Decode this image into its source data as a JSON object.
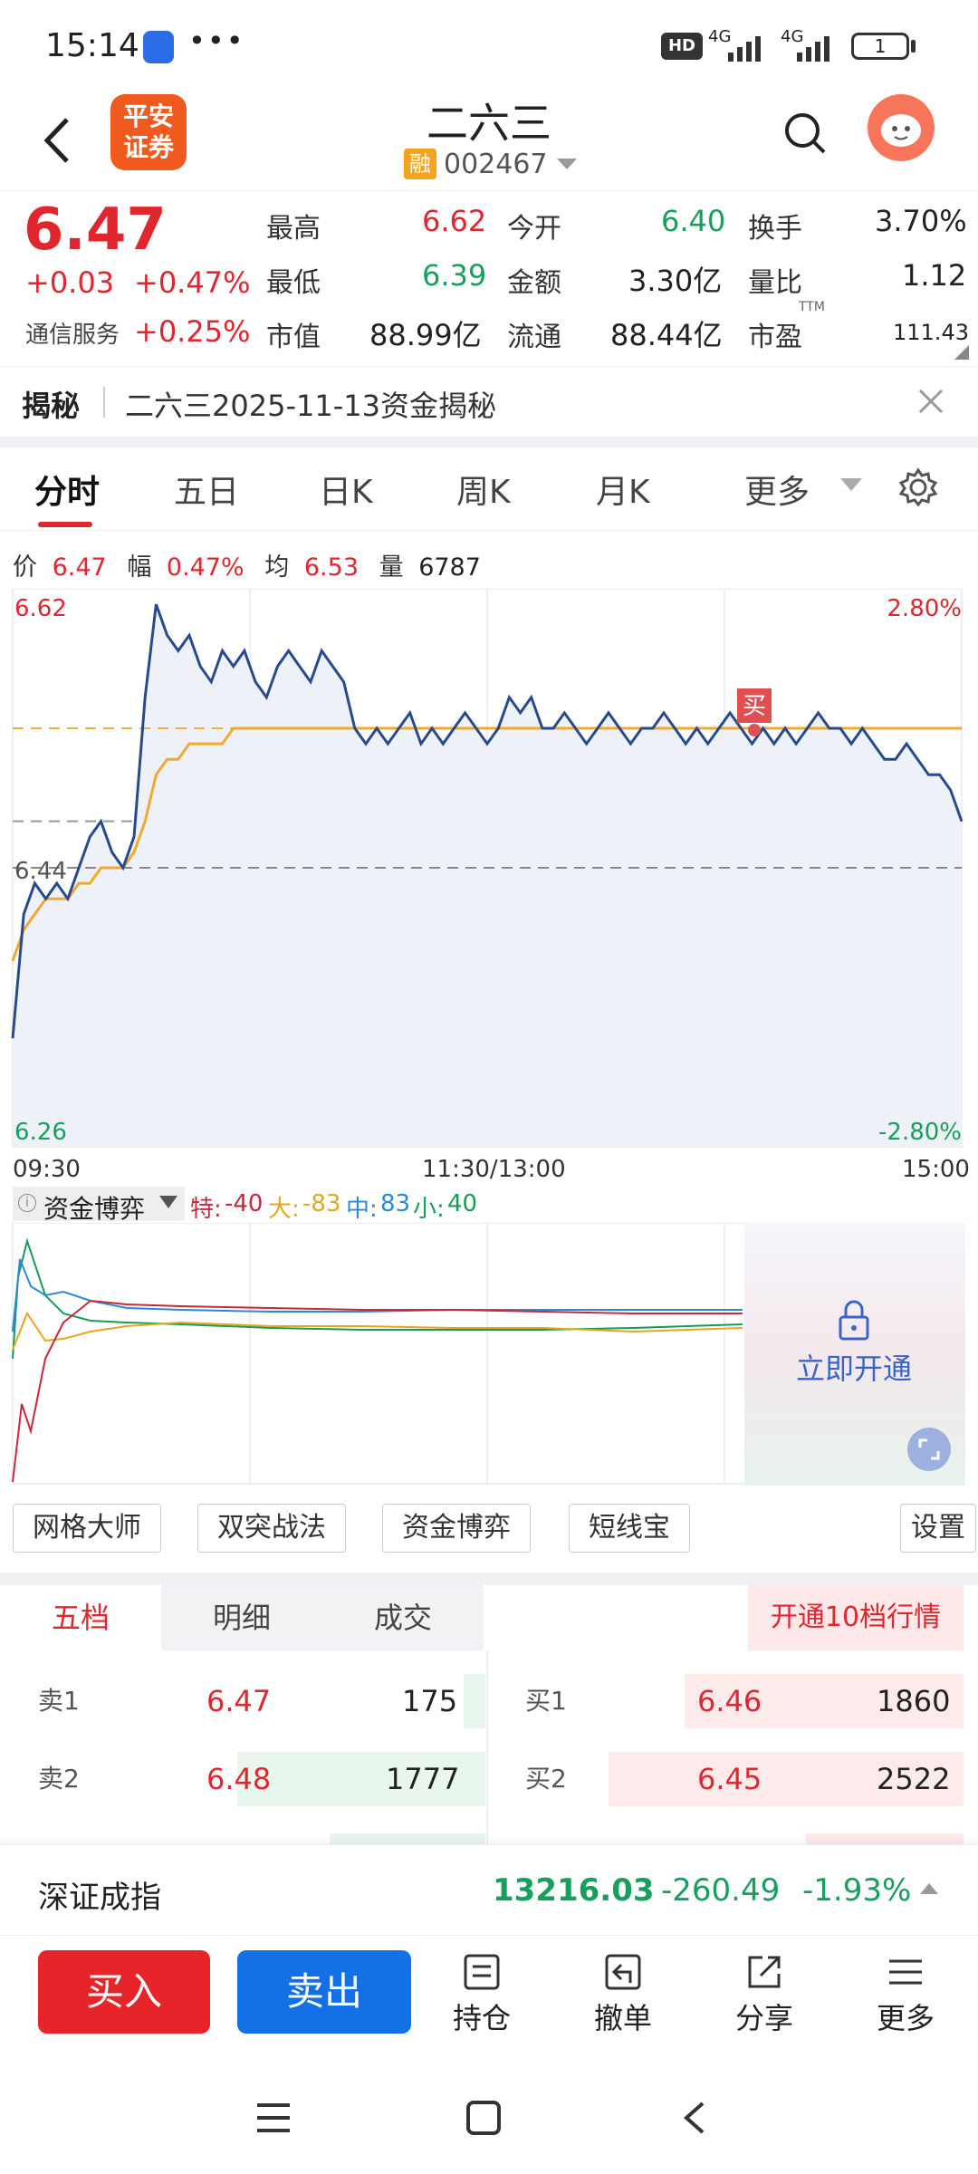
{
  "status": {
    "time": "15:14",
    "dots": "•••",
    "net1": "4G",
    "net2": "4G",
    "battery": "1",
    "hd": "HD"
  },
  "header": {
    "stock_name": "二六三",
    "code": "002467",
    "rong": "融",
    "logo_line1": "平安",
    "logo_line2": "证券"
  },
  "quote": {
    "price": "6.47",
    "change": "+0.03",
    "change_pct": "+0.47%",
    "sector": "通信服务",
    "sector_pct": "+0.25%",
    "rows": [
      {
        "l1": "最高",
        "v1": "6.62",
        "l2": "今开",
        "v2": "6.40",
        "l3": "换手",
        "v3": "3.70%"
      },
      {
        "l1": "最低",
        "v1": "6.39",
        "l2": "金额",
        "v2": "3.30亿",
        "l3": "量比",
        "v3": "1.12"
      },
      {
        "l1": "市值",
        "v1": "88.99亿",
        "l2": "流通",
        "v2": "88.44亿",
        "l3": "市盈",
        "v3": "111.43",
        "ttm": "TTM"
      }
    ]
  },
  "banner": {
    "tag": "揭秘",
    "text": "二六三2025-11-13资金揭秘"
  },
  "tabs": [
    "分时",
    "五日",
    "日K",
    "周K",
    "月K",
    "更多"
  ],
  "chart_info": {
    "l_price": "价",
    "price": "6.47",
    "l_amp": "幅",
    "amp": "0.47%",
    "l_avg": "均",
    "avg": "6.53",
    "l_vol": "量",
    "vol": "6787"
  },
  "chart_data": {
    "type": "line",
    "ylim": [
      6.26,
      6.62
    ],
    "y_left_top": "6.62",
    "y_left_bottom": "6.26",
    "y_left_mid": "6.44",
    "y_right_top": "2.80%",
    "y_right_bottom": "-2.80%",
    "x_ticks": [
      "09:30",
      "11:30/13:00",
      "15:00"
    ],
    "buy_marker": "买",
    "series": [
      {
        "values": [
          6.33,
          6.41,
          6.43,
          6.42,
          6.43,
          6.42,
          6.44,
          6.46,
          6.47,
          6.45,
          6.44,
          6.46,
          6.55,
          6.61,
          6.59,
          6.58,
          6.59,
          6.57,
          6.56,
          6.58,
          6.57,
          6.58,
          6.56,
          6.55,
          6.57,
          6.58,
          6.57,
          6.56,
          6.58,
          6.57,
          6.56,
          6.53,
          6.52,
          6.53,
          6.52,
          6.53,
          6.54,
          6.52,
          6.53,
          6.52,
          6.53,
          6.54,
          6.53,
          6.52,
          6.53,
          6.55,
          6.54,
          6.55,
          6.53,
          6.53,
          6.54,
          6.53,
          6.52,
          6.53,
          6.54,
          6.53,
          6.52,
          6.53,
          6.53,
          6.54,
          6.53,
          6.52,
          6.53,
          6.52,
          6.53,
          6.54,
          6.53,
          6.52,
          6.53,
          6.52,
          6.53,
          6.52,
          6.53,
          6.54,
          6.53,
          6.53,
          6.52,
          6.53,
          6.52,
          6.51,
          6.51,
          6.52,
          6.51,
          6.5,
          6.5,
          6.49,
          6.47
        ]
      },
      {
        "values": [
          6.38,
          6.4,
          6.41,
          6.42,
          6.42,
          6.42,
          6.43,
          6.43,
          6.44,
          6.44,
          6.44,
          6.45,
          6.47,
          6.5,
          6.51,
          6.51,
          6.52,
          6.52,
          6.52,
          6.52,
          6.53,
          6.53,
          6.53,
          6.53,
          6.53,
          6.53,
          6.53,
          6.53,
          6.53,
          6.53,
          6.53,
          6.53,
          6.53,
          6.53,
          6.53,
          6.53,
          6.53,
          6.53,
          6.53,
          6.53,
          6.53,
          6.53,
          6.53,
          6.53,
          6.53,
          6.53,
          6.53,
          6.53,
          6.53,
          6.53,
          6.53,
          6.53,
          6.53,
          6.53,
          6.53,
          6.53,
          6.53,
          6.53,
          6.53,
          6.53,
          6.53,
          6.53,
          6.53,
          6.53,
          6.53,
          6.53,
          6.53,
          6.53,
          6.53,
          6.53,
          6.53,
          6.53,
          6.53,
          6.53,
          6.53,
          6.53,
          6.53,
          6.53,
          6.53,
          6.53,
          6.53,
          6.53,
          6.53,
          6.53,
          6.53,
          6.53,
          6.53
        ]
      }
    ],
    "prev_close": 6.44
  },
  "flow": {
    "title": "资金博弈",
    "te_label": "特:",
    "te": "-40",
    "da_label": "大:",
    "da": "-83",
    "zhong_label": "中:",
    "zhong": "83",
    "xiao_label": "小:",
    "xiao": "40",
    "unlock": "立即开通"
  },
  "strategies": [
    "网格大师",
    "双突战法",
    "资金博弈",
    "短线宝"
  ],
  "settings_label": "设置",
  "orderbook": {
    "tabs": [
      "五档",
      "明细",
      "成交"
    ],
    "upgrade": "开通10档行情",
    "sells": [
      {
        "label": "卖1",
        "price": "6.47",
        "vol": "175"
      },
      {
        "label": "卖2",
        "price": "6.48",
        "vol": "1777"
      }
    ],
    "buys": [
      {
        "label": "买1",
        "price": "6.46",
        "vol": "1860"
      },
      {
        "label": "买2",
        "price": "6.45",
        "vol": "2522"
      }
    ]
  },
  "index": {
    "name": "深证成指",
    "value": "13216.03",
    "change": "-260.49",
    "pct": "-1.93%"
  },
  "actions": {
    "buy": "买入",
    "sell": "卖出",
    "hold": "持仓",
    "cancel": "撤单",
    "share": "分享",
    "more": "更多"
  }
}
